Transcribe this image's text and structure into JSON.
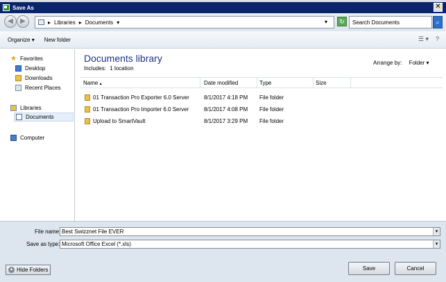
{
  "window": {
    "title": "Save As"
  },
  "address": {
    "crumbs": [
      "Libraries",
      "Documents"
    ]
  },
  "search": {
    "placeholder": "Search Documents"
  },
  "toolbar": {
    "organize": "Organize",
    "new_folder": "New folder"
  },
  "nav": {
    "favorites": "Favorites",
    "desktop": "Desktop",
    "downloads": "Downloads",
    "recent": "Recent Places",
    "libraries": "Libraries",
    "documents": "Documents",
    "computer": "Computer"
  },
  "library": {
    "title": "Documents library",
    "includes_label": "Includes:",
    "includes_value": "1 location",
    "arrange_label": "Arrange by:",
    "arrange_value": "Folder"
  },
  "columns": {
    "name": "Name",
    "date": "Date modified",
    "type": "Type",
    "size": "Size"
  },
  "files": [
    {
      "name": "01 Transaction Pro Exporter 6.0 Server",
      "date": "8/1/2017 4:18 PM",
      "type": "File folder"
    },
    {
      "name": "01 Transaction Pro Importer 6.0 Server",
      "date": "8/1/2017 4:08 PM",
      "type": "File folder"
    },
    {
      "name": "Upload to SmartVault",
      "date": "8/1/2017 3:29 PM",
      "type": "File folder"
    }
  ],
  "form": {
    "filename_label": "File name:",
    "filename_value": "Best Swizznet File EVER",
    "savetype_label": "Save as type:",
    "savetype_value": "Microsoft Office Excel (*.xls)"
  },
  "buttons": {
    "hide_folders": "Hide Folders",
    "save": "Save",
    "cancel": "Cancel"
  }
}
